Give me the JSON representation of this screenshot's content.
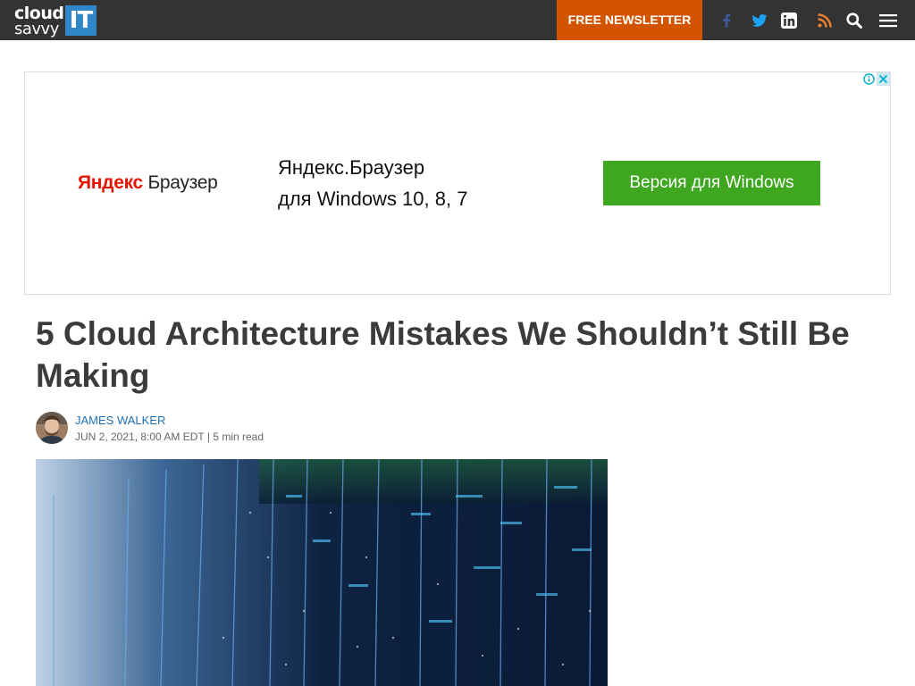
{
  "header": {
    "logo": {
      "word1": "cloud",
      "word2": "savvy",
      "badge": "IT"
    },
    "newsletter_label": "FREE NEWSLETTER",
    "icons": [
      "facebook-icon",
      "twitter-icon",
      "linkedin-icon",
      "rss-icon",
      "search-icon",
      "menu-icon"
    ]
  },
  "ad": {
    "brand_red": "Яндекс",
    "brand_rest": " Браузер",
    "line1": "Яндекс.Браузер",
    "line2": "для Windows 10, 8, 7",
    "cta": "Версия для Windows"
  },
  "article": {
    "title_line1": "5 Cloud Architecture Mistakes We Shouldn’t Still Be",
    "title_line2": "Making",
    "author": "JAMES WALKER",
    "date": "JUN 2, 2021, 8:00 AM EDT",
    "separator": "|",
    "read_time": "5 min read"
  },
  "colors": {
    "header_bg": "#333333",
    "accent": "#d35400",
    "link": "#1f6fb2",
    "ad_button": "#3ea61f",
    "logo_badge": "#2f86c8"
  }
}
